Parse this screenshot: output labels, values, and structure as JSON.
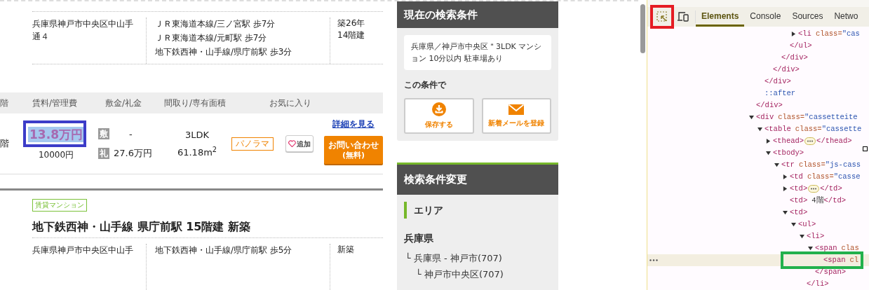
{
  "listing_top": {
    "address": "兵庫県神戸市中央区中山手通４",
    "stations": [
      "ＪＲ東海道本線/三ノ宮駅 歩7分",
      "ＪＲ東海道本線/元町駅 歩7分",
      "地下鉄西神・山手線/県庁前駅 歩3分"
    ],
    "age": [
      "築26年",
      "14階建"
    ]
  },
  "rooms_table": {
    "columns": [
      "階",
      "賃料/管理費",
      "敷金/礼金",
      "間取り/専有面積",
      "お気に入り"
    ],
    "rows": [
      {
        "floor": "階",
        "rent": "13.8万円",
        "text_selected": true,
        "framed": true,
        "fee": "10000円",
        "deposit_label": "敷",
        "deposit": "-",
        "key_money_label": "礼",
        "key_money": "27.6万円",
        "layout": "3LDK",
        "area": "61.18m$^{2}$",
        "tag": "パノラマ",
        "favorite_button": "追加",
        "detail_link": "詳細を見る",
        "inquiry_button": "お問い合わせ",
        "inquiry_note": "(無料)"
      }
    ]
  },
  "listing_next": {
    "category": "賃貸マンション",
    "title": "地下鉄西神・山手線 県庁前駅 15階建 新築",
    "address": "兵庫県神戸市中央区中山手",
    "stations": [
      "地下鉄西神・山手線/県庁前駅 歩5分"
    ],
    "age": [
      "新築"
    ]
  },
  "sidebar": {
    "current_search": {
      "title": "現在の検索条件",
      "conditions": "兵庫県／神戸市中央区＂3LDK マンション 10分以内 駐車場あり",
      "subtitle": "この条件で",
      "buttons": [
        {
          "kind": "save",
          "label": "保存する"
        },
        {
          "kind": "mail",
          "label": "新着メールを登録"
        }
      ]
    },
    "change_search": {
      "title": "検索条件変更",
      "section": "エリア",
      "prefecture": "兵庫県",
      "areas": [
        {
          "label": "└ 兵庫県 - 神戸市(707)",
          "children": [
            {
              "label": "└ 神戸市中央区(707)"
            }
          ]
        }
      ]
    }
  },
  "devtools": {
    "inspect_framed": true,
    "tabs": [
      {
        "label": "Elements",
        "selected": true
      },
      {
        "label": "Console",
        "selected": false
      },
      {
        "label": "Sources",
        "selected": false
      },
      {
        "label": "Netwo",
        "selected": false
      }
    ],
    "dom": [
      {
        "children": [
          {
            "children": [
              {
                "children": [
                  {
                    "children": [
                      {
                        "children": [
                          {
                            "tag": "<li",
                            "attr": "class=",
                            "value": "\"cas",
                            "expanded": false,
                            "selected": false
                          }
                        ]
                      },
                      {
                        "close": "</ul>",
                        "selected": false
                      }
                    ]
                  },
                  {
                    "close": "</div>",
                    "selected": false
                  }
                ]
              },
              {
                "close": "</div>",
                "selected": false
              }
            ]
          },
          {
            "close": "</div>",
            "selected": false
          },
          {
            "pseudo": "::after",
            "selected": false
          }
        ]
      },
      {
        "close": "</div>",
        "selected": false
      },
      {
        "tag": "<div",
        "attr": "class=",
        "value": "\"cassetteite",
        "expanded": true,
        "selected": false,
        "children": [
          {
            "tag": "<table",
            "attr": "class=",
            "value": "\"cassette",
            "expanded": true,
            "selected": false,
            "children": [
              {
                "tag": "<thead>",
                "ellipsis": true,
                "close": "</thead>",
                "expanded": false,
                "selected": false
              },
              {
                "tag": "<tbody>",
                "expanded": true,
                "selected": false,
                "children": [
                  {
                    "tag": "<tr",
                    "attr": "class=",
                    "value": "\"js-cass",
                    "expanded": true,
                    "selected": false,
                    "children": [
                      {
                        "tag": "<td",
                        "attr": "class=",
                        "value": "\"casse",
                        "expanded": false,
                        "selected": false
                      },
                      {
                        "tag": "<td>",
                        "ellipsis": true,
                        "close": "</td>",
                        "expanded": false,
                        "selected": false
                      },
                      {
                        "tag": "<td>",
                        "content": "4階",
                        "close": "</td>",
                        "selected": false
                      },
                      {
                        "tag": "<td>",
                        "expanded": true,
                        "selected": false,
                        "children": [
                          {
                            "tag": "<ul>",
                            "expanded": true,
                            "selected": false,
                            "children": [
                              {
                                "tag": "<li>",
                                "expanded": true,
                                "selected": false,
                                "children": [
                                  {
                                    "tag": "<span",
                                    "attr": "clas",
                                    "expanded": true,
                                    "selected": false,
                                    "children": [
                                      {
                                        "tag": "<span",
                                        "attr": "cl",
                                        "selected": true,
                                        "framed": true
                                      }
                                    ]
                                  },
                                  {
                                    "close": "</span>",
                                    "selected": false
                                  }
                                ]
                              },
                              {
                                "close": "</li>",
                                "selected": false
                              }
                            ]
                          }
                        ]
                      }
                    ]
                  }
                ]
              }
            ]
          }
        ]
      }
    ]
  }
}
